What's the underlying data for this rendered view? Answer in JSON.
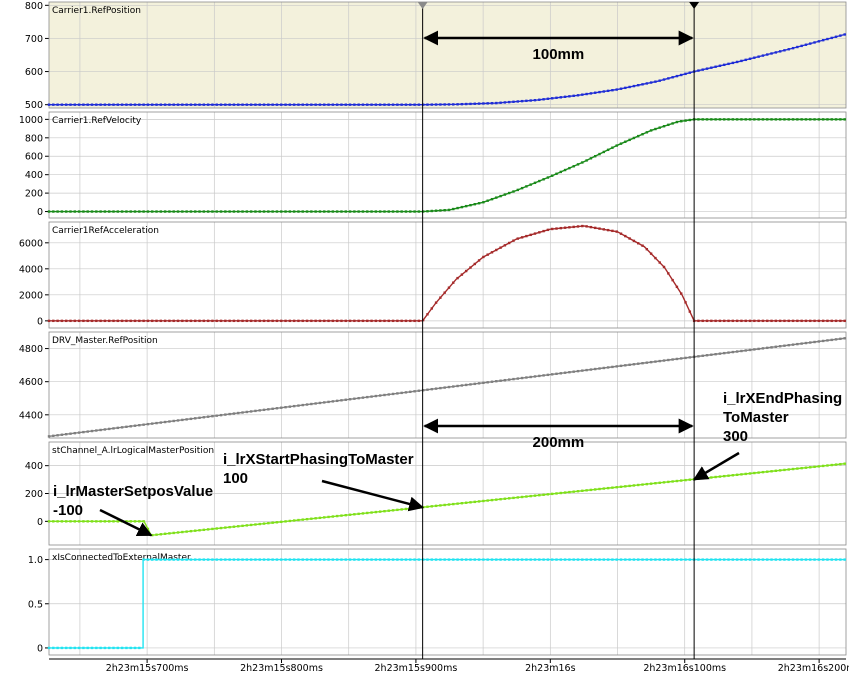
{
  "chart_data": {
    "type": "line",
    "colors": {
      "background": "#ffffff",
      "shade": "#f3f1dc",
      "grid": "#c9c9c9",
      "panel_border": "#8a8a8a",
      "cursor": "#000000",
      "annotation": "#000000"
    },
    "x_axis": {
      "ticks": [
        {
          "value": 700,
          "label": "2h23m15s700ms"
        },
        {
          "value": 800,
          "label": "2h23m15s800ms"
        },
        {
          "value": 900,
          "label": "2h23m15s900ms"
        },
        {
          "value": 1000,
          "label": "2h23m16s"
        },
        {
          "value": 1100,
          "label": "2h23m16s100ms"
        },
        {
          "value": 1200,
          "label": "2h23m16s200ms"
        }
      ],
      "xlim": [
        627,
        1220
      ]
    },
    "cursors": [
      905,
      1107
    ],
    "series": [
      {
        "name": "Carrier1.RefPosition",
        "color": "#1f2dd6",
        "ylim": [
          490,
          810
        ],
        "yticks": [
          500,
          600,
          700,
          800
        ],
        "shaded": true,
        "points": [
          [
            627,
            500
          ],
          [
            905,
            500
          ],
          [
            930,
            501
          ],
          [
            960,
            505
          ],
          [
            990,
            514
          ],
          [
            1020,
            528
          ],
          [
            1050,
            546
          ],
          [
            1080,
            571
          ],
          [
            1107,
            600
          ],
          [
            1140,
            630
          ],
          [
            1180,
            670
          ],
          [
            1220,
            713
          ]
        ]
      },
      {
        "name": "Carrier1.RefVelocity",
        "color": "#1a8a1a",
        "ylim": [
          -70,
          1080
        ],
        "yticks": [
          0,
          200,
          400,
          600,
          800,
          1000
        ],
        "shaded": false,
        "points": [
          [
            627,
            0
          ],
          [
            905,
            0
          ],
          [
            925,
            18
          ],
          [
            950,
            100
          ],
          [
            975,
            230
          ],
          [
            1000,
            380
          ],
          [
            1025,
            540
          ],
          [
            1050,
            720
          ],
          [
            1075,
            880
          ],
          [
            1095,
            975
          ],
          [
            1107,
            1000
          ],
          [
            1220,
            1000
          ]
        ]
      },
      {
        "name": "Carrier1RefAcceleration",
        "color": "#a52a2a",
        "ylim": [
          -550,
          7600
        ],
        "yticks": [
          0,
          2000,
          4000,
          6000
        ],
        "shaded": false,
        "points": [
          [
            627,
            0
          ],
          [
            905,
            0
          ],
          [
            915,
            1400
          ],
          [
            930,
            3200
          ],
          [
            950,
            4900
          ],
          [
            975,
            6300
          ],
          [
            1000,
            7050
          ],
          [
            1025,
            7300
          ],
          [
            1050,
            6850
          ],
          [
            1070,
            5700
          ],
          [
            1085,
            4100
          ],
          [
            1098,
            2000
          ],
          [
            1107,
            0
          ],
          [
            1220,
            0
          ]
        ]
      },
      {
        "name": "DRV_Master.RefPosition",
        "color": "#7f7f7f",
        "ylim": [
          4260,
          4900
        ],
        "yticks": [
          4400,
          4600,
          4800
        ],
        "shaded": false,
        "points": [
          [
            627,
            4270
          ],
          [
            1220,
            4863
          ]
        ]
      },
      {
        "name": "stChannel_A.lrLogicalMasterPosition",
        "color": "#7fe01a",
        "ylim": [
          -170,
          570
        ],
        "yticks": [
          0,
          200,
          400
        ],
        "shaded": false,
        "points": [
          [
            627,
            0
          ],
          [
            698,
            0
          ],
          [
            698,
            -5
          ],
          [
            703,
            -100
          ],
          [
            1220,
            415
          ]
        ]
      },
      {
        "name": "xIsConnectedToExternalMaster",
        "color": "#22e3f0",
        "ylim": [
          -0.08,
          1.12
        ],
        "yticks": [
          {
            "value": 0,
            "label": "0"
          },
          {
            "value": 0.5,
            "label": "0.5"
          },
          {
            "value": 1.0,
            "label": "1.0"
          }
        ],
        "shaded": false,
        "points": [
          [
            627,
            0
          ],
          [
            697,
            0
          ],
          [
            697,
            1
          ],
          [
            1220,
            1
          ]
        ]
      }
    ],
    "measurements": [
      {
        "panel": 0,
        "from": 905,
        "to": 1107,
        "label": "100mm"
      },
      {
        "panel": 3,
        "from": 905,
        "to": 1107,
        "label": "200mm"
      }
    ],
    "annotations": [
      {
        "lines": [
          "i_lrMasterSetposValue",
          "-100"
        ],
        "target": [
          703,
          -100
        ]
      },
      {
        "lines": [
          "i_lrXStartPhasingToMaster",
          "100"
        ],
        "target": [
          905,
          100
        ]
      },
      {
        "lines": [
          "i_lrXEndPhasing",
          "ToMaster",
          "300"
        ],
        "target": [
          1107,
          300
        ]
      }
    ]
  }
}
